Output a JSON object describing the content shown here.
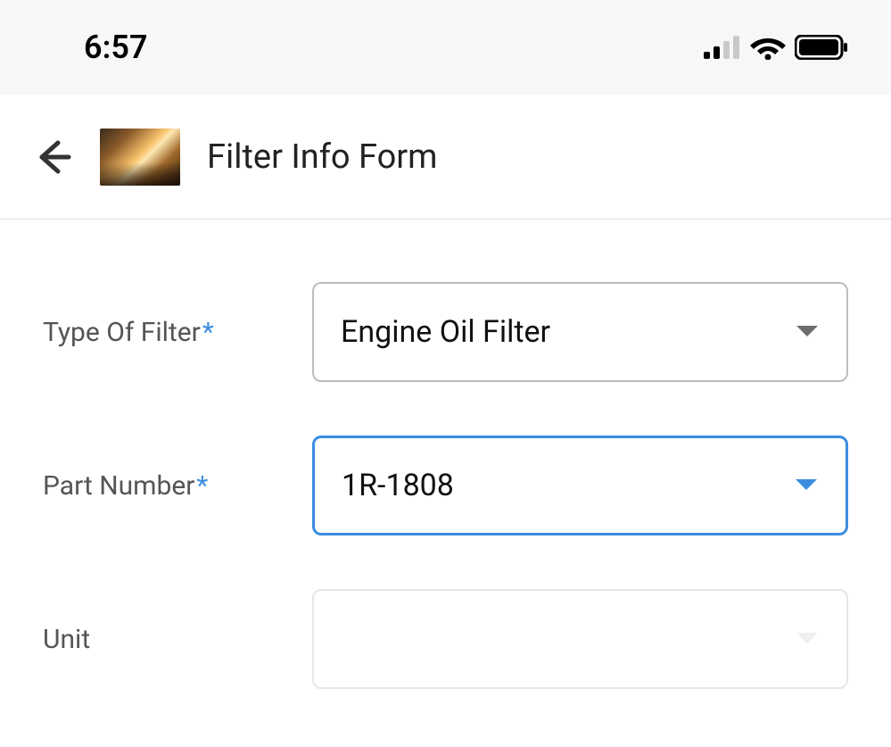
{
  "status": {
    "time": "6:57"
  },
  "header": {
    "title": "Filter Info Form"
  },
  "form": {
    "type_of_filter": {
      "label": "Type Of Filter",
      "required": true,
      "value": "Engine Oil Filter"
    },
    "part_number": {
      "label": "Part Number",
      "required": true,
      "value": "1R-1808"
    },
    "unit": {
      "label": "Unit",
      "required": false,
      "value": ""
    }
  }
}
